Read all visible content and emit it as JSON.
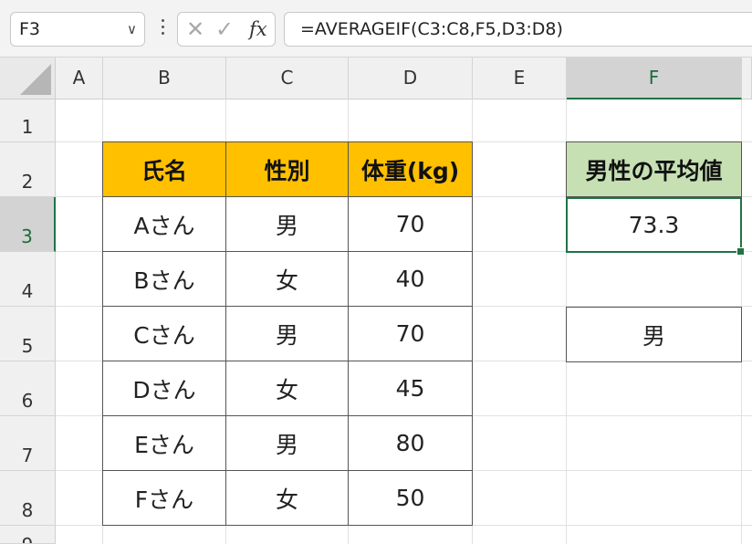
{
  "formula_bar": {
    "name_box": "F3",
    "cancel_icon": "x-icon",
    "enter_icon": "check-icon",
    "fx_label": "fx",
    "formula": "=AVERAGEIF(C3:C8,F5,D3:D8)"
  },
  "columns": [
    "A",
    "B",
    "C",
    "D",
    "E",
    "F"
  ],
  "rows": [
    "1",
    "2",
    "3",
    "4",
    "5",
    "6",
    "7",
    "8",
    "9"
  ],
  "table": {
    "headers": [
      "氏名",
      "性別",
      "体重(kg)"
    ],
    "rows": [
      [
        "Aさん",
        "男",
        "70"
      ],
      [
        "Bさん",
        "女",
        "40"
      ],
      [
        "Cさん",
        "男",
        "70"
      ],
      [
        "Dさん",
        "女",
        "45"
      ],
      [
        "Eさん",
        "男",
        "80"
      ],
      [
        "Fさん",
        "女",
        "50"
      ]
    ]
  },
  "result": {
    "label": "男性の平均値",
    "value": "73.3",
    "criteria": "男"
  },
  "selection": {
    "active_cell": "F3"
  },
  "colors": {
    "header_fill": "#ffc000",
    "result_label_fill": "#c6e0b4",
    "selection": "#217346"
  }
}
